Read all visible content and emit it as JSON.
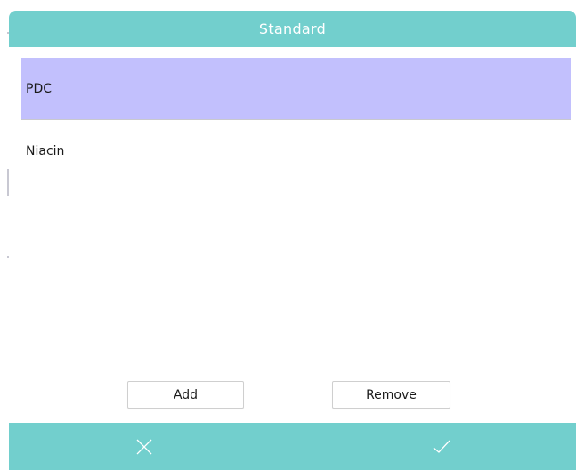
{
  "dialog": {
    "title": "Standard",
    "items": [
      {
        "label": "PDC",
        "selected": true
      },
      {
        "label": "Niacin",
        "selected": false
      }
    ],
    "add_label": "Add",
    "remove_label": "Remove",
    "footer": {
      "cancel_icon": "close-icon",
      "confirm_icon": "check-icon"
    }
  },
  "colors": {
    "header_bg": "#72cfcd",
    "selected_row_bg": "#c2c0fd",
    "footer_bg": "#72cfcd"
  }
}
